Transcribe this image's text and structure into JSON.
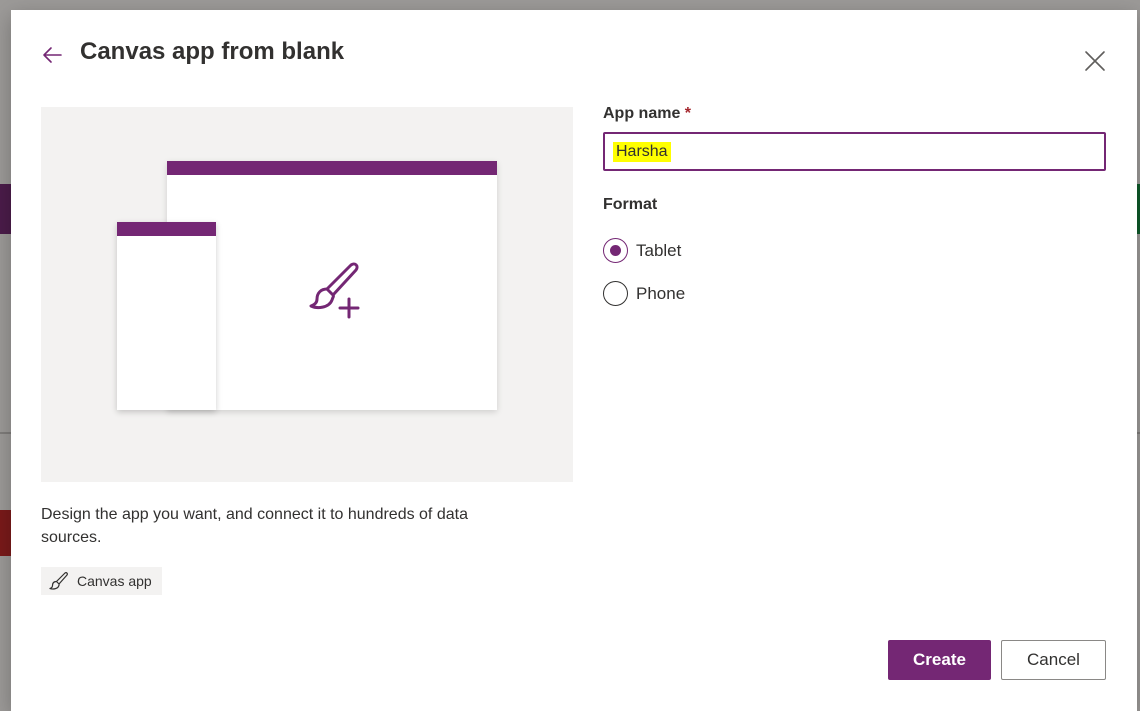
{
  "dialog": {
    "title": "Canvas app from blank",
    "description": "Design the app you want, and connect it to hundreds of data sources.",
    "tag_label": "Canvas app",
    "colors": {
      "accent": "#742774",
      "required": "#a4262c",
      "highlight": "#ffff00"
    }
  },
  "form": {
    "app_name_label": "App name",
    "required_mark": "*",
    "app_name_value": "Harsha",
    "format_label": "Format",
    "format_options": [
      {
        "label": "Tablet",
        "selected": true
      },
      {
        "label": "Phone",
        "selected": false
      }
    ]
  },
  "actions": {
    "create_label": "Create",
    "cancel_label": "Cancel"
  },
  "icons": {
    "back": "arrow-left-icon",
    "close": "close-icon",
    "illustration": "brush-plus-icon",
    "tag": "brush-icon"
  }
}
